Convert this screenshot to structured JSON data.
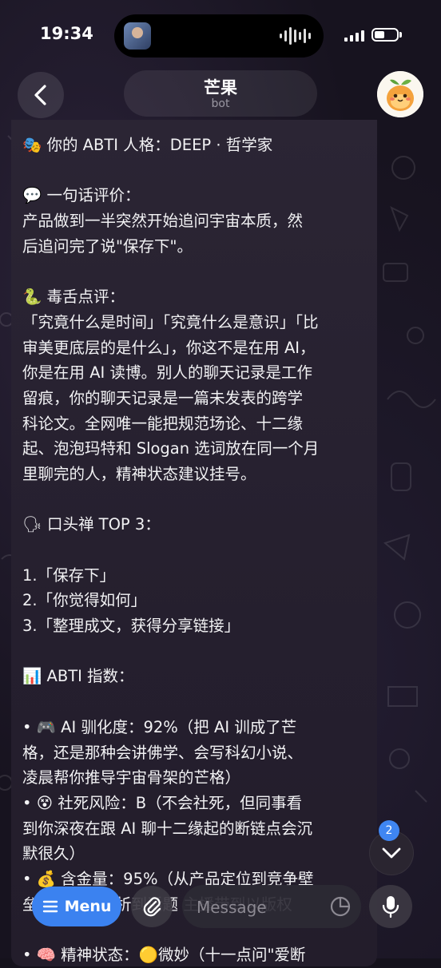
{
  "status_bar": {
    "time": "19:34"
  },
  "header": {
    "back_icon": "chevron-left-icon",
    "title": "芒果",
    "subtitle": "bot",
    "avatar": "mango-mascot"
  },
  "message_lines": [
    "🎭 你的 ABTI 人格：DEEP · 哲学家",
    "",
    "💬 一句话评价：",
    "产品做到一半突然开始追问宇宙本质，然",
    "后追问完了说\"保存下\"。",
    "",
    "🐍 毒舌点评：",
    "「究竟什么是时间」「究竟什么是意识」「比",
    "审美更底层的是什么」，你这不是在用 AI，",
    "你是在用 AI 读博。别人的聊天记录是工作",
    "留痕，你的聊天记录是一篇未发表的跨学",
    "科论文。全网唯一能把规范场论、十二缘",
    "起、泡泡玛特和 Slogan 选词放在同一个月",
    "里聊完的人，精神状态建议挂号。",
    "",
    "🗣 口头禅 TOP 3：",
    "",
    "1.「保存下」",
    "2.「你觉得如何」",
    "3.「整理成文，获得分享链接」",
    "",
    "📊 ABTI 指数：",
    "",
    "• 🎮 AI 驯化度：92%（把 AI 训成了芒",
    "格，还是那种会讲佛学、会写科幻小说、",
    "凌晨帮你推导宇宙骨架的芒格）",
    "• 😵 社死风险：B（不会社死，但同事看",
    "到你深夜在跟 AI 聊十二缘起的断链点会沉",
    "默很久）",
    "• 💰 含金量：95%（从产品定位到竞争壁",
    "垒，从认知分析到话题 主播带到以版权",
    "",
    "• 🧠 精神状态：🟡微妙（十一点问\"爱断"
  ],
  "scroll_down": {
    "badge_count": "2"
  },
  "input_bar": {
    "menu_label": "Menu",
    "placeholder": "Message"
  }
}
